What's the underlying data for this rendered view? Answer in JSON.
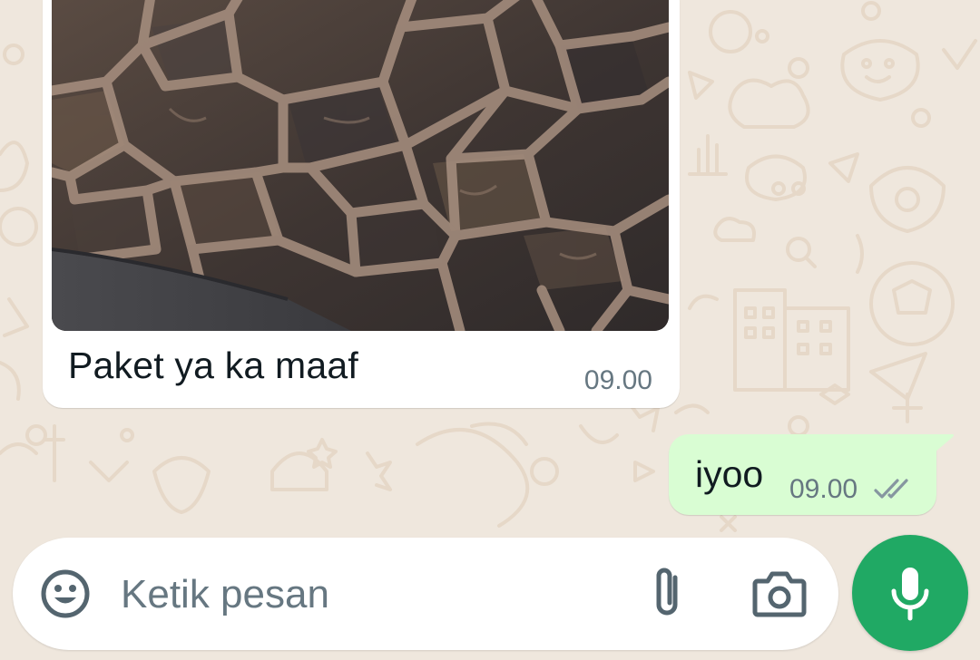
{
  "theme": {
    "wallpaper": "#efe7dd",
    "incoming_bubble": "#ffffff",
    "outgoing_bubble": "#d9fdd3",
    "accent": "#20a964",
    "secondary_text": "#667781"
  },
  "messages": [
    {
      "direction": "incoming",
      "type": "image",
      "caption": "Paket ya ka maaf",
      "time": "09.00"
    },
    {
      "direction": "outgoing",
      "type": "text",
      "text": "iyoo",
      "time": "09.00",
      "status_icon": "double-check-icon"
    }
  ],
  "composer": {
    "placeholder": "Ketik pesan",
    "icons": [
      "emoji-icon",
      "attach-icon",
      "camera-icon"
    ],
    "send_icon": "mic-icon"
  }
}
